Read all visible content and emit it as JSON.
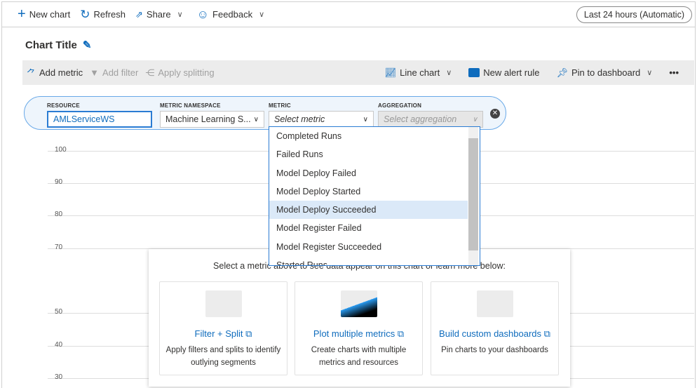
{
  "topbar": {
    "new_chart": "New chart",
    "refresh": "Refresh",
    "share": "Share",
    "feedback": "Feedback",
    "time_range": "Last 24 hours (Automatic)"
  },
  "chart_title": "Chart Title",
  "toolbar": {
    "add_metric": "Add metric",
    "add_filter": "Add filter",
    "apply_splitting": "Apply splitting",
    "line_chart": "Line chart",
    "new_alert_rule": "New alert rule",
    "pin_to_dashboard": "Pin to dashboard",
    "more": "•••"
  },
  "metric_row": {
    "resource_label": "RESOURCE",
    "resource_value": "AMLServiceWS",
    "namespace_label": "METRIC NAMESPACE",
    "namespace_value": "Machine Learning S...",
    "metric_label": "METRIC",
    "metric_placeholder": "Select metric",
    "aggregation_label": "AGGREGATION",
    "aggregation_placeholder": "Select aggregation"
  },
  "metric_options": [
    "Completed Runs",
    "Failed Runs",
    "Model Deploy Failed",
    "Model Deploy Started",
    "Model Deploy Succeeded",
    "Model Register Failed",
    "Model Register Succeeded",
    "Started Runs"
  ],
  "highlighted_option": "Model Deploy Succeeded",
  "y_axis": [
    "100",
    "90",
    "80",
    "70",
    "50",
    "40",
    "30"
  ],
  "empty_panel": {
    "heading": "Select a metric above to see data appear on this chart or learn more below:",
    "cards": [
      {
        "title": "Filter + Split",
        "desc": "Apply filters and splits to identify outlying segments"
      },
      {
        "title": "Plot multiple metrics",
        "desc": "Create charts with multiple metrics and resources"
      },
      {
        "title": "Build custom dashboards",
        "desc": "Pin charts to your dashboards"
      }
    ]
  }
}
